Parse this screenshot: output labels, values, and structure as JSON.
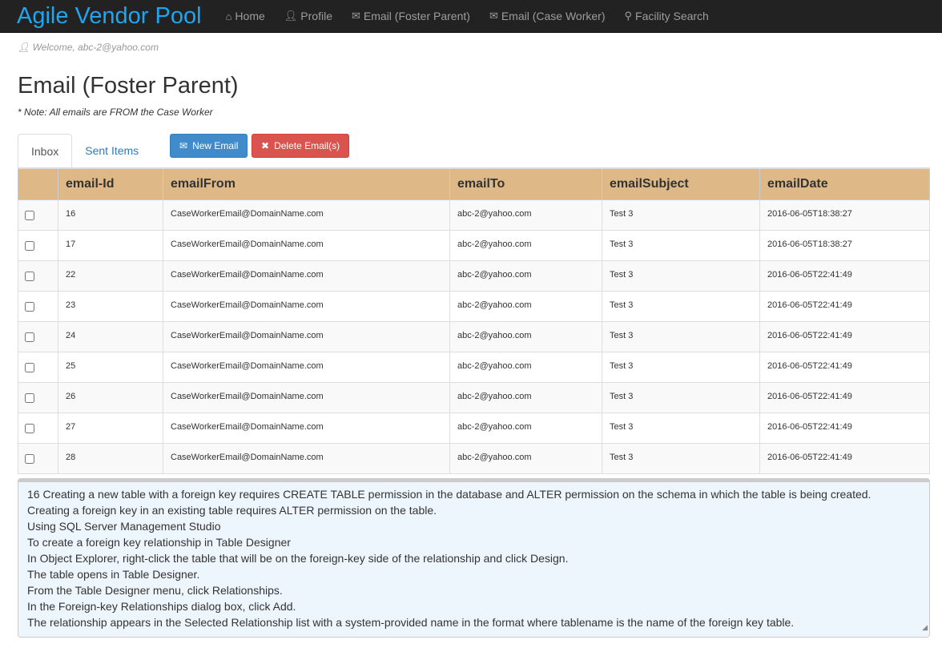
{
  "nav": {
    "brand": "Agile Vendor Pool",
    "items": [
      {
        "label": "Home",
        "icon": "home-icon"
      },
      {
        "label": "Profile",
        "icon": "user-icon"
      },
      {
        "label": "Email (Foster Parent)",
        "icon": "envelope-icon"
      },
      {
        "label": "Email (Case Worker)",
        "icon": "envelope-icon"
      },
      {
        "label": "Facility Search",
        "icon": "search-icon"
      }
    ]
  },
  "welcome": "Welcome, abc-2@yahoo.com",
  "title": "Email (Foster Parent)",
  "note": "* Note: All emails are FROM the Case Worker",
  "tabs": [
    "Inbox",
    "Sent Items"
  ],
  "buttons": {
    "new": "New Email",
    "delete": "Delete Email(s)"
  },
  "colors": {
    "header": "#deb887",
    "brand": "#1ea6f0",
    "new": "#428bca",
    "delete": "#d9534f"
  },
  "table": {
    "headers": [
      "email-Id",
      "emailFrom",
      "emailTo",
      "emailSubject",
      "emailDate"
    ],
    "rows": [
      [
        "16",
        "CaseWorkerEmail@DomainName.com",
        "abc-2@yahoo.com",
        "Test 3",
        "2016-06-05T18:38:27"
      ],
      [
        "17",
        "CaseWorkerEmail@DomainName.com",
        "abc-2@yahoo.com",
        "Test 3",
        "2016-06-05T18:38:27"
      ],
      [
        "22",
        "CaseWorkerEmail@DomainName.com",
        "abc-2@yahoo.com",
        "Test 3",
        "2016-06-05T22:41:49"
      ],
      [
        "23",
        "CaseWorkerEmail@DomainName.com",
        "abc-2@yahoo.com",
        "Test 3",
        "2016-06-05T22:41:49"
      ],
      [
        "24",
        "CaseWorkerEmail@DomainName.com",
        "abc-2@yahoo.com",
        "Test 3",
        "2016-06-05T22:41:49"
      ],
      [
        "25",
        "CaseWorkerEmail@DomainName.com",
        "abc-2@yahoo.com",
        "Test 3",
        "2016-06-05T22:41:49"
      ],
      [
        "26",
        "CaseWorkerEmail@DomainName.com",
        "abc-2@yahoo.com",
        "Test 3",
        "2016-06-05T22:41:49"
      ],
      [
        "27",
        "CaseWorkerEmail@DomainName.com",
        "abc-2@yahoo.com",
        "Test 3",
        "2016-06-05T22:41:49"
      ],
      [
        "28",
        "CaseWorkerEmail@DomainName.com",
        "abc-2@yahoo.com",
        "Test 3",
        "2016-06-05T22:41:49"
      ]
    ]
  },
  "message": "16 Creating a new table with a foreign key requires CREATE TABLE permission in the database and ALTER permission on the schema in which the table is being created.\nCreating a foreign key in an existing table requires ALTER permission on the table.\nUsing SQL Server Management Studio\nTo create a foreign key relationship in Table Designer\nIn Object Explorer, right-click the table that will be on the foreign-key side of the relationship and click Design.\nThe table opens in Table Designer.\nFrom the Table Designer menu, click Relationships.\nIn the Foreign-key Relationships dialog box, click Add.\nThe relationship appears in the Selected Relationship list with a system-provided name in the format  where tablename is the name of the foreign key table."
}
